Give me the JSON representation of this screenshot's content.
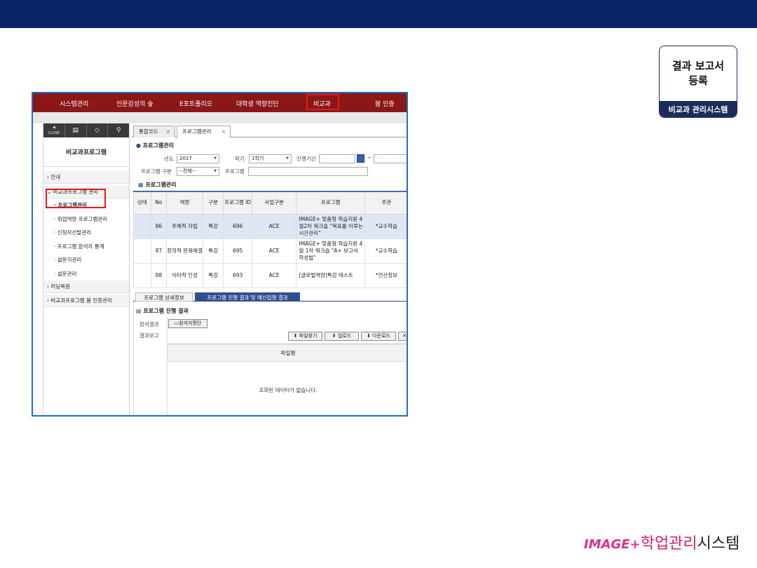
{
  "badge": {
    "line1": "결과 보고서",
    "line2": "등록",
    "footer": "비교과 관리시스템"
  },
  "menu": {
    "items": [
      "시스템관리",
      "인문감성의 숲",
      "E포트폴리오",
      "대학생 역량진단",
      "비교과",
      "봄 인증"
    ]
  },
  "sidebar": {
    "close_label": "CLOSE",
    "title": "비교과프로그램",
    "groups": [
      {
        "label": "› 안내"
      },
      {
        "label": "⌄ 비교과프로그램 관리"
      }
    ],
    "items": [
      "· 프로그램관리",
      "· 취업역량 프로그램관리",
      "· 신청자선발관리",
      "· 프로그램 참석자 통계",
      "· 설문지관리",
      "· 설문관리"
    ],
    "groups_bottom": [
      "› 러닝목원",
      "› 비교과프로그램 봄 인증관리"
    ]
  },
  "tabs": [
    "통합코드",
    "프로그램관리"
  ],
  "search": {
    "section_title": "프로그램관리",
    "year_label": "년도",
    "year_value": "2017",
    "semester_label": "학기",
    "semester_value": "1학기",
    "period_label": "진행기간",
    "date_sep": "~",
    "date_placeholder": "-    -",
    "type_label": "프로그램 구분",
    "type_value": "--전체--",
    "program_label": "프로그램"
  },
  "grid": {
    "section_title": "프로그램관리",
    "headers": [
      "상태",
      "No",
      "역량",
      "구분",
      "프로그램 ID",
      "사업구분",
      "프로그램",
      "주관"
    ],
    "rows": [
      {
        "no": "86",
        "competency": "주체적 자립",
        "type": "특강",
        "id": "696",
        "biz": "ACE",
        "program": "IMAGE+ 맞춤형 학습지원 4월2차 워크숍 \"목표를 이루는 시간관리\"",
        "host": "*교수학습"
      },
      {
        "no": "87",
        "competency": "창의적 문제해결",
        "type": "특강",
        "id": "695",
        "biz": "ACE",
        "program": "IMAGE+ 맞춤형 학습지원 4월 1차 워크숍 \"A+ 보고서 작성법\"",
        "host": "*교수학습"
      },
      {
        "no": "88",
        "competency": "이타적 인성",
        "type": "특강",
        "id": "693",
        "biz": "ACE",
        "program": "[글로벌역량]특강 테스트",
        "host": "*전산정보"
      }
    ]
  },
  "subtabs": [
    "프로그램 상세정보",
    "프로그램 진행 결과 및 예산집행 결과"
  ],
  "result": {
    "section_title": "프로그램 진행 결과",
    "attend_label": "참석결과",
    "attend_button": "참석자명단",
    "report_label": "결과보고",
    "buttons": [
      "파일찾기",
      "업로드",
      "다운로드"
    ],
    "file_header": "파일명",
    "empty_text": "조회된 데이터가 없습니다."
  },
  "logo": {
    "brand": "IMAGE+",
    "text": "학업관리",
    "text2": "시스템"
  },
  "colors": {
    "topbar": "#0b2466",
    "menubar": "#8b1717",
    "highlight": "#e81818",
    "frame": "#1e6fc8"
  }
}
